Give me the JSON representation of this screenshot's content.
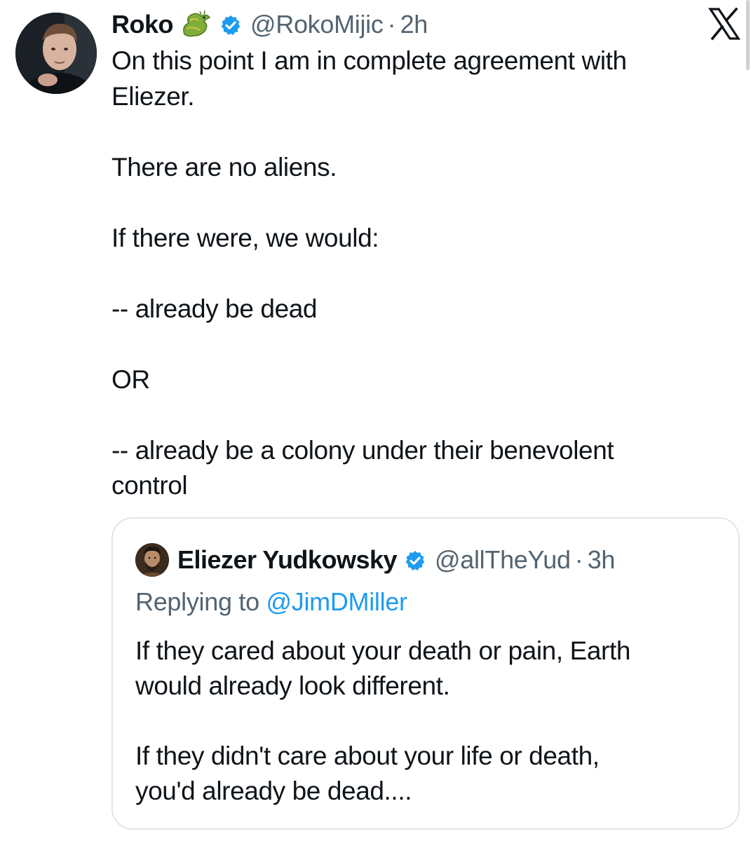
{
  "tweet": {
    "author": {
      "display_name": "Roko",
      "emoji_icon": "dragon-emoji-icon",
      "verified_icon": "verified-badge-icon",
      "handle": "@RokoMijic",
      "separator": "·",
      "time": "2h"
    },
    "platform_icon": "x-logo-icon",
    "body_lines": [
      "On this point I am in complete agreement with",
      "Eliezer.",
      "",
      "There are no aliens.",
      "",
      "If there were, we would:",
      "",
      "-- already be dead",
      "",
      "OR",
      "",
      "-- already be a colony under their benevolent",
      "control"
    ]
  },
  "quoted_tweet": {
    "author": {
      "display_name": "Eliezer Yudkowsky",
      "verified_icon": "verified-badge-icon",
      "handle": "@allTheYud",
      "separator": "·",
      "time": "3h"
    },
    "replying_to_label": "Replying to",
    "replying_to_handle": "@JimDMiller",
    "body_lines": [
      "If they cared about your death or pain, Earth",
      "would already look different.",
      "",
      "If they didn't care about your life or death,",
      "you'd already be dead...."
    ]
  },
  "colors": {
    "text": "#0f1419",
    "secondary": "#536471",
    "link": "#1d9bf0",
    "verified": "#1d9bf0",
    "border": "#e1e6ea"
  }
}
